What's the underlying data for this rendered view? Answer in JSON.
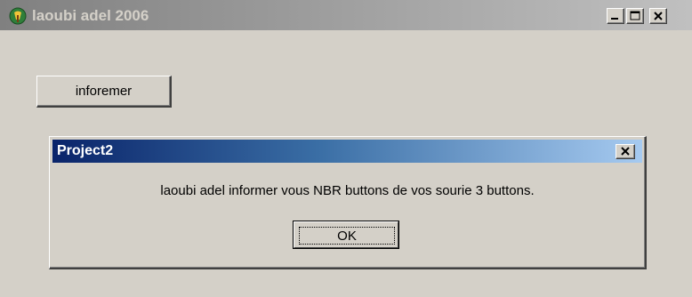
{
  "window": {
    "title": "laoubi adel 2006",
    "icon": "application-icon",
    "controls": [
      "minimize-icon",
      "maximize-icon",
      "close-icon"
    ]
  },
  "main": {
    "button_label": "inforemer"
  },
  "dialog": {
    "title": "Project2",
    "message": "laoubi adel informer  vous NBR buttons de  vos sourie 3 buttons.",
    "ok_label": "OK",
    "close_icon": "close-icon"
  },
  "colors": {
    "face": "#d4d0c8",
    "inactive_title_start": "#808080",
    "active_title_start": "#0a246a",
    "active_title_end": "#a6caf0"
  }
}
